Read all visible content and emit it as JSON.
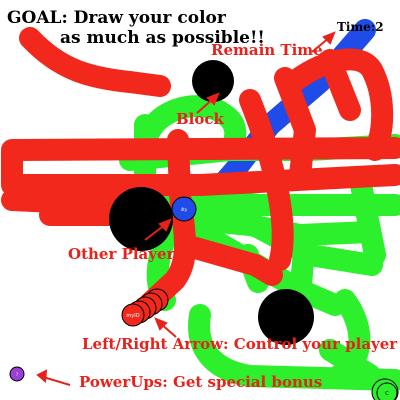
{
  "instructions": {
    "goal_line1": "GOAL: Draw your color",
    "goal_line2": "as much as possible!!"
  },
  "timer": {
    "readout": "Time:2",
    "label": "Remain Time"
  },
  "annotations": {
    "block": "Block",
    "other_player": "Other Player",
    "controls": "Left/Right Arrow: Control your player",
    "powerups": "PowerUps: Get special bonus"
  },
  "players": {
    "self_id": "myID",
    "other_id": "4ty"
  },
  "powerup_badges": {
    "left": "?",
    "corner": "C"
  },
  "colors": {
    "self_trail": "#f2281c",
    "opponent_trail": "#2bf02b",
    "blue_trail": "#1f4be8",
    "block": "#000000",
    "annotation": "#e8221b",
    "powerup": "#9b3fd6",
    "other_player_head": "#1f4be8"
  }
}
